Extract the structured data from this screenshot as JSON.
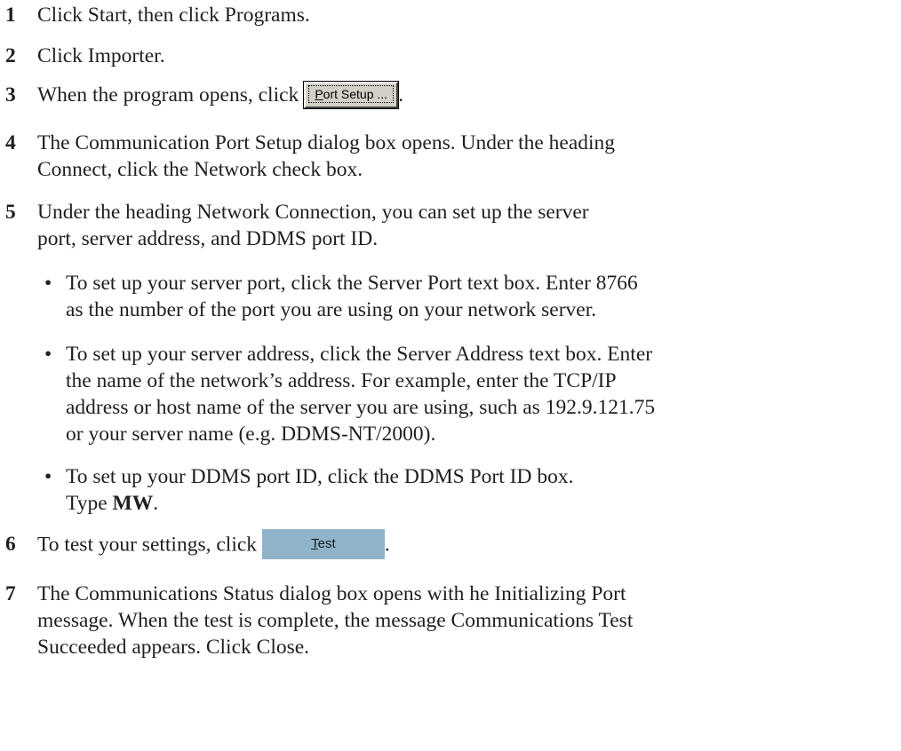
{
  "steps": [
    {
      "num": "1",
      "text": "Click Start, then click Programs."
    },
    {
      "num": "2",
      "text": "Click Importer."
    },
    {
      "num": "3",
      "text": "When the program opens, click",
      "after": "."
    },
    {
      "num": "4",
      "lines": [
        "The Communication Port  Setup dialog box opens. Under the heading",
        "Connect, click the Network check box."
      ]
    },
    {
      "num": "5",
      "lines": [
        "Under the heading Network Connection, you can set up the server",
        "port, server address, and DDMS port ID."
      ]
    },
    {
      "num": "6",
      "text": "To test your settings, click",
      "after": "."
    },
    {
      "num": "7",
      "lines": [
        "The Communications Status dialog box opens with he Initializing Port",
        "message. When the test is complete, the message Communications Test",
        "Succeeded appears. Click Close."
      ]
    }
  ],
  "bullets": [
    {
      "dot": "•",
      "lines": [
        "To set up your server port, click the Server Port text box. Enter 8766",
        "as the number of the port you are using on your network server."
      ]
    },
    {
      "dot": "•",
      "lines": [
        "To set up your server address, click the Server Address text box. Enter",
        "the name of the network’s address. For example, enter the TCP/IP",
        "address or host name of the server you are using, such as 192.9.121.75",
        "or your server name (e.g. DDMS-NT/2000)."
      ]
    },
    {
      "dot": "•",
      "line1": "To set up your DDMS port ID, click the DDMS Port ID box.",
      "line2_prefix": "Type ",
      "line2_bold": "MW",
      "line2_suffix": "."
    }
  ],
  "buttons": {
    "port_setup": {
      "underlined": "P",
      "rest": "ort Setup ..."
    },
    "test": {
      "underlined": "T",
      "rest": "est"
    }
  },
  "colors": {
    "test_button_bg": "#8fb3c9",
    "windows_button_bg": "#d4d0c8"
  }
}
